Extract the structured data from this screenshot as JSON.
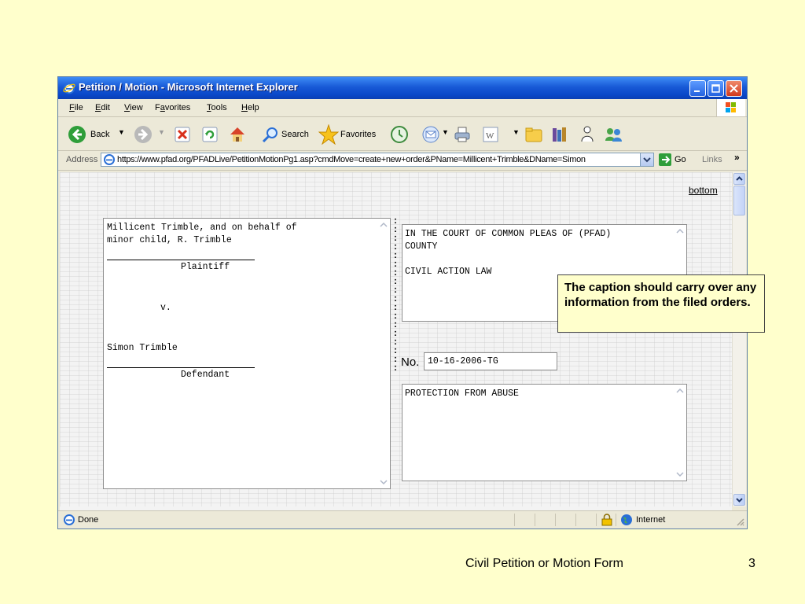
{
  "window": {
    "title": "Petition / Motion - Microsoft Internet Explorer"
  },
  "menu": [
    {
      "pre": "",
      "u": "F",
      "post": "ile"
    },
    {
      "pre": "",
      "u": "E",
      "post": "dit"
    },
    {
      "pre": "",
      "u": "V",
      "post": "iew"
    },
    {
      "pre": "F",
      "u": "a",
      "post": "vorites"
    },
    {
      "pre": "",
      "u": "T",
      "post": "ools"
    },
    {
      "pre": "",
      "u": "H",
      "post": "elp"
    }
  ],
  "toolbar": {
    "back_label": "Back",
    "search_label": "Search",
    "favorites_label": "Favorites"
  },
  "address": {
    "label": "Address",
    "url": "https://www.pfad.org/PFADLive/PetitionMotionPg1.asp?cmdMove=create+new+order&PName=Millicent+Trimble&DName=Simon",
    "go_label": "Go",
    "links_label": "Links"
  },
  "page": {
    "bottom_link": "bottom",
    "plaintiff_text": "Millicent Trimble, and on behalf of\nminor child, R. Trimble",
    "plaintiff_label": "Plaintiff",
    "versus": "v.",
    "defendant_name": "Simon Trimble",
    "defendant_label": "Defendant",
    "court_text": "IN THE COURT OF COMMON PLEAS OF (PFAD)\nCOUNTY\n\nCIVIL ACTION LAW",
    "no_label": "No.",
    "case_number": "10-16-2006-TG",
    "case_type": "PROTECTION FROM ABUSE"
  },
  "status": {
    "text": "Done",
    "zone": "Internet"
  },
  "callout": {
    "text": "The caption should carry over any information from the filed orders."
  },
  "slide": {
    "footer_title": "Civil Petition or Motion Form",
    "page_number": "3"
  },
  "colors": {
    "slide_background": "#FFFFCC",
    "titlebar_blue": "#0a48c9",
    "window_chrome": "#ECE9D8"
  }
}
